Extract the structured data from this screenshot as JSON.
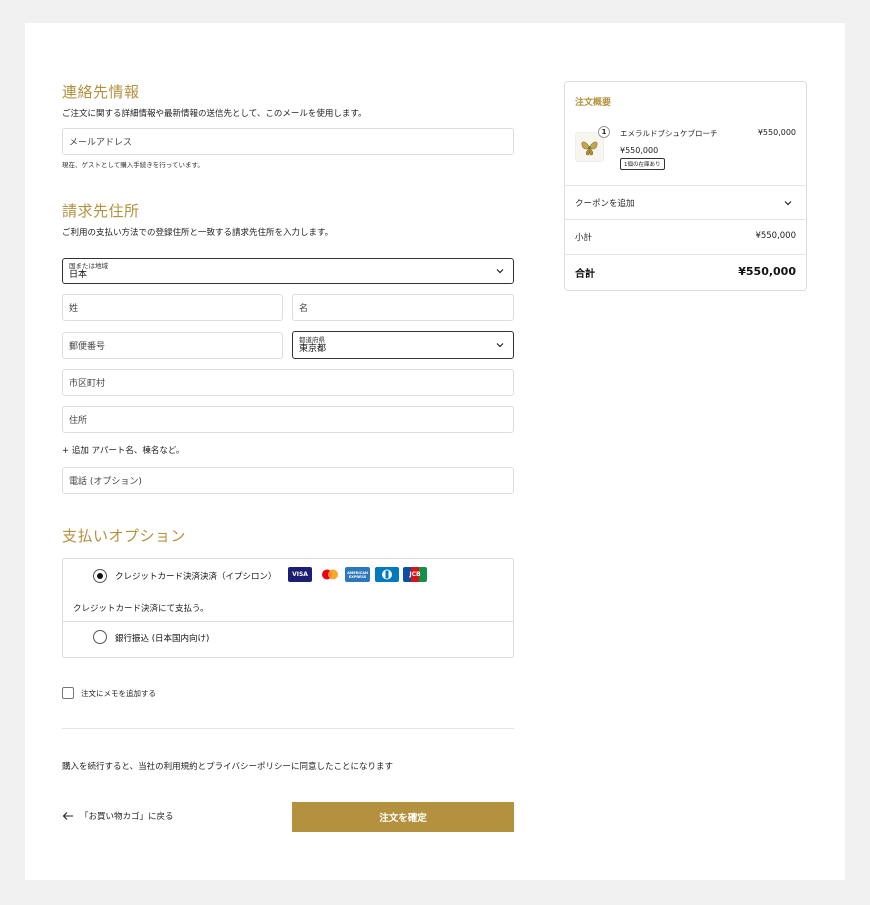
{
  "contact": {
    "heading": "連絡先情報",
    "description": "ご注文に関する詳細情報や最新情報の送信先として、このメールを使用します。",
    "email_placeholder": "メールアドレス",
    "guest_note": "現在、ゲストとして購入手続きを行っています。"
  },
  "billing": {
    "heading": "請求先住所",
    "description": "ご利用の支払い方法での登録住所と一致する請求先住所を入力します。",
    "country_label": "国または地域",
    "country_value": "日本",
    "last_name_placeholder": "姓",
    "first_name_placeholder": "名",
    "postal_placeholder": "郵便番号",
    "prefecture_label": "都道府県",
    "prefecture_value": "東京都",
    "city_placeholder": "市区町村",
    "address_placeholder": "住所",
    "add_apartment": "+ 追加 アパート名、棟名など。",
    "phone_placeholder": "電話 (オプション)"
  },
  "payment": {
    "heading": "支払いオプション",
    "option1_label": "クレジットカード決済決済（イプシロン）",
    "option1_desc": "クレジットカード決済にて支払う。",
    "option2_label": "銀行振込 (日本国内向け)",
    "cards": {
      "visa": "VISA",
      "amex": "AMERICAN EXPRESS",
      "jcb": "JCB"
    }
  },
  "note_checkbox_label": "注文にメモを追加する",
  "terms_text": "購入を続行すると、当社の利用規約とプライバシーポリシーに同意したことになります",
  "back_link": "「お買い物カゴ」に戻る",
  "confirm_button": "注文を確定",
  "summary": {
    "title": "注文概要",
    "item_name": "エメラルドブシュケブローチ",
    "item_price": "¥550,000",
    "item_unit_price": "¥550,000",
    "item_quantity": "1",
    "stock_badge": "1個の在庫あり",
    "coupon_label": "クーポンを追加",
    "subtotal_label": "小計",
    "subtotal_value": "¥550,000",
    "total_label": "合計",
    "total_value": "¥550,000"
  },
  "colors": {
    "accent": "#b4913f",
    "border": "#dddddd",
    "background": "#f0f0f0"
  }
}
